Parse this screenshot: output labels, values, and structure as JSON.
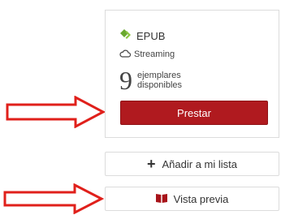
{
  "format": {
    "label": "EPUB",
    "icon": "epub-icon",
    "icon_color": "#6aa82f"
  },
  "streaming": {
    "label": "Streaming",
    "icon": "cloud-icon"
  },
  "copies": {
    "count": "9",
    "label_line1": "ejemplares",
    "label_line2": "disponibles"
  },
  "actions": {
    "borrow_label": "Prestar",
    "add_to_list_label": "Añadir a mi lista",
    "preview_label": "Vista previa"
  },
  "colors": {
    "borrow_button": "#b01a1f",
    "annotation_arrow": "#e0201b",
    "preview_icon": "#a8141a"
  },
  "icons": {
    "add": "plus-icon",
    "preview": "book-icon",
    "annotation": "arrow-right-icon"
  }
}
